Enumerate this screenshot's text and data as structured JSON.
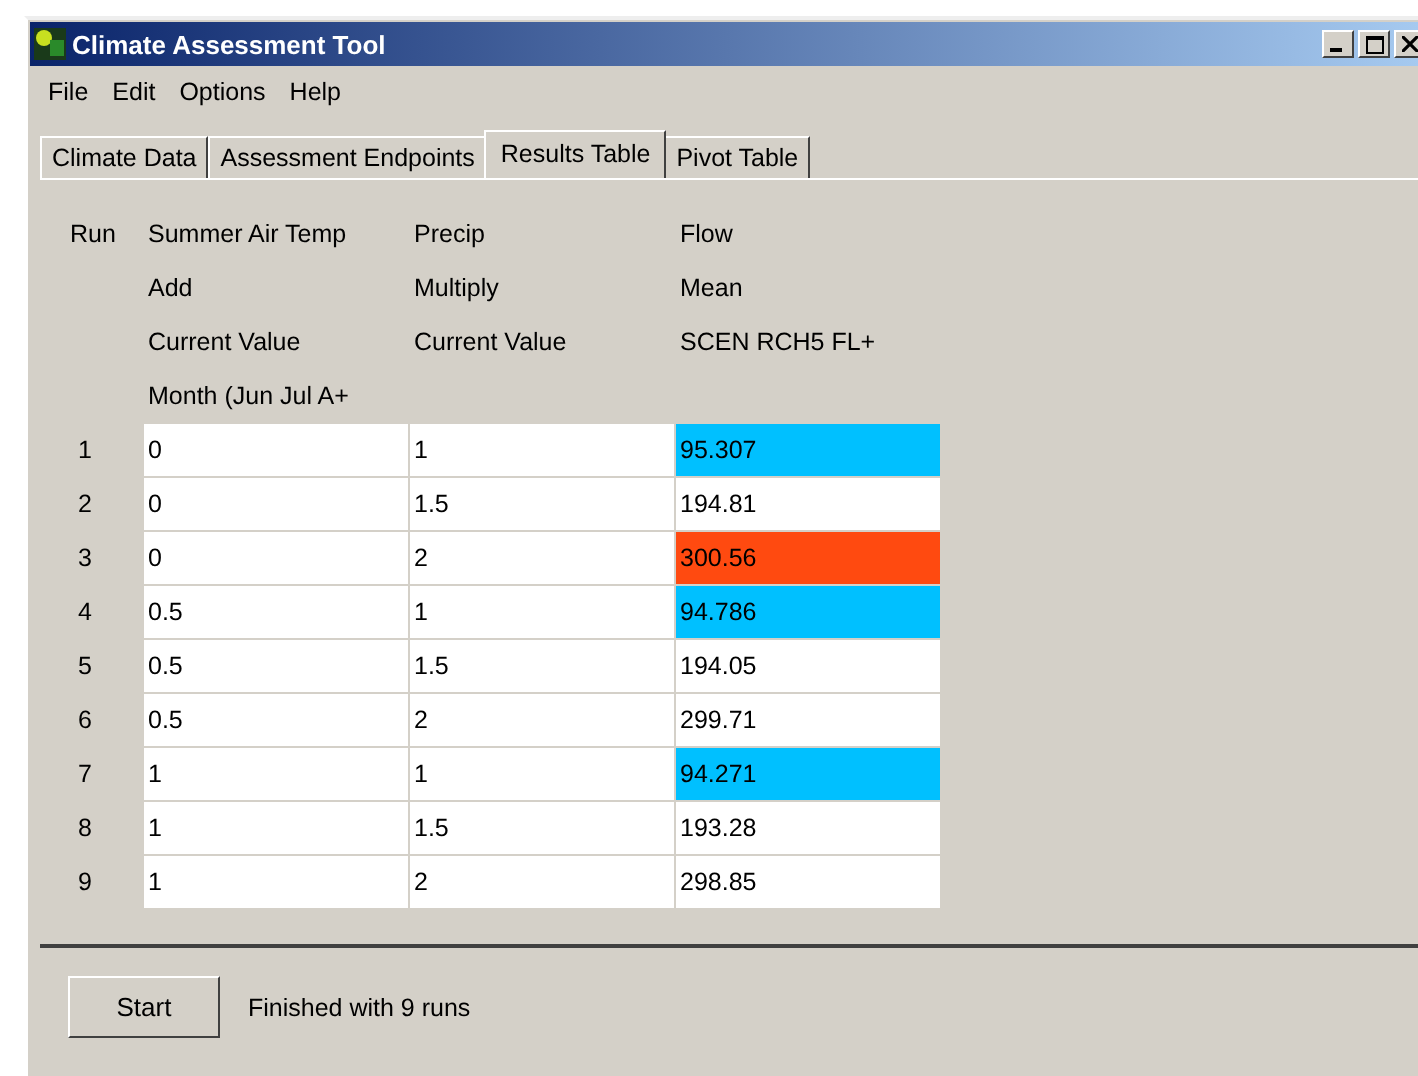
{
  "window": {
    "title": "Climate Assessment Tool"
  },
  "menu": [
    "File",
    "Edit",
    "Options",
    "Help"
  ],
  "tabs": [
    {
      "label": "Climate Data",
      "selected": false
    },
    {
      "label": "Assessment Endpoints",
      "selected": false
    },
    {
      "label": "Results Table",
      "selected": true
    },
    {
      "label": "Pivot Table",
      "selected": false
    }
  ],
  "table": {
    "columns": [
      {
        "lines": [
          "Run"
        ]
      },
      {
        "lines": [
          "Summer Air Temp",
          "Add",
          "Current Value",
          "Month (Jun Jul A+"
        ]
      },
      {
        "lines": [
          "Precip",
          "Multiply",
          "Current Value"
        ]
      },
      {
        "lines": [
          "Flow",
          "Mean",
          "SCEN RCH5 FL+"
        ]
      }
    ],
    "rows": [
      {
        "run": "1",
        "temp": "0",
        "precip": "1",
        "flow": "95.307",
        "color": "#00c0ff"
      },
      {
        "run": "2",
        "temp": "0",
        "precip": "1.5",
        "flow": "194.81",
        "color": "#ffffff"
      },
      {
        "run": "3",
        "temp": "0",
        "precip": "2",
        "flow": "300.56",
        "color": "#ff4a10"
      },
      {
        "run": "4",
        "temp": "0.5",
        "precip": "1",
        "flow": "94.786",
        "color": "#00c0ff"
      },
      {
        "run": "5",
        "temp": "0.5",
        "precip": "1.5",
        "flow": "194.05",
        "color": "#ffffff"
      },
      {
        "run": "6",
        "temp": "0.5",
        "precip": "2",
        "flow": "299.71",
        "color": "#ffffff"
      },
      {
        "run": "7",
        "temp": "1",
        "precip": "1",
        "flow": "94.271",
        "color": "#00c0ff"
      },
      {
        "run": "8",
        "temp": "1",
        "precip": "1.5",
        "flow": "193.28",
        "color": "#ffffff"
      },
      {
        "run": "9",
        "temp": "1",
        "precip": "2",
        "flow": "298.85",
        "color": "#ffffff"
      }
    ]
  },
  "start_button": "Start",
  "status": "Finished with 9 runs"
}
